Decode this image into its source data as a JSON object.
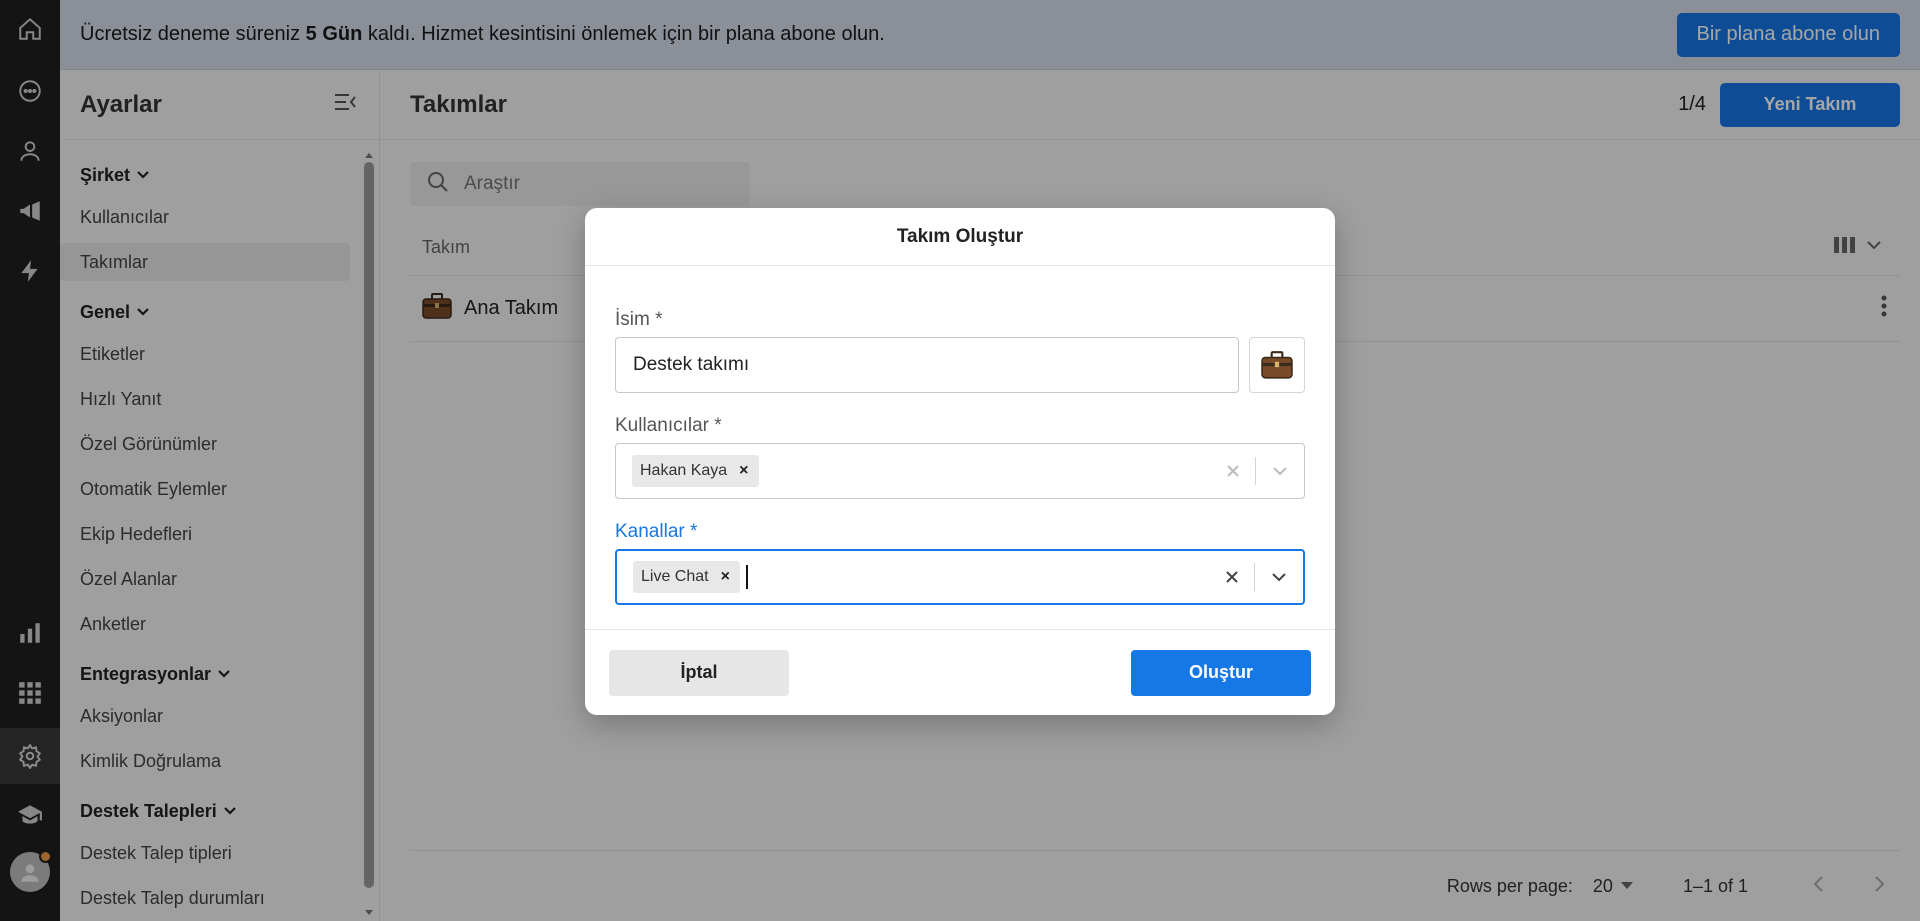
{
  "banner": {
    "prefix": "Ücretsiz deneme süreniz ",
    "days": "5 Gün",
    "suffix": " kaldı. Hizmet kesintisini önlemek için bir plana abone olun.",
    "subscribe_label": "Bir plana abone olun"
  },
  "sidebar": {
    "title": "Ayarlar",
    "groups": [
      {
        "label": "Şirket",
        "items": [
          "Kullanıcılar",
          "Takımlar"
        ]
      },
      {
        "label": "Genel",
        "items": [
          "Etiketler",
          "Hızlı Yanıt",
          "Özel Görünümler",
          "Otomatik Eylemler",
          "Ekip Hedefleri",
          "Özel Alanlar",
          "Anketler"
        ]
      },
      {
        "label": "Entegrasyonlar",
        "items": [
          "Aksiyonlar",
          "Kimlik Doğrulama"
        ]
      },
      {
        "label": "Destek Talepleri",
        "items": [
          "Destek Talep tipleri",
          "Destek Talep durumları"
        ]
      }
    ],
    "active_item": "Takımlar"
  },
  "main": {
    "title": "Takımlar",
    "count": "1/4",
    "new_team_label": "Yeni Takım",
    "search_placeholder": "Araştır",
    "column_team": "Takım",
    "rows": [
      {
        "name": "Ana Takım"
      }
    ],
    "footer": {
      "rows_per_page_label": "Rows per page:",
      "rows_per_page_value": "20",
      "range": "1–1 of 1"
    }
  },
  "modal": {
    "title": "Takım Oluştur",
    "name_label": "İsim *",
    "name_value": "Destek takımı",
    "users_label": "Kullanıcılar *",
    "users_chips": [
      "Hakan Kaya"
    ],
    "channels_label": "Kanallar *",
    "channels_chips": [
      "Live Chat"
    ],
    "cancel_label": "İptal",
    "create_label": "Oluştur"
  },
  "colors": {
    "accent": "#1677e6",
    "rail": "#1f1f1f",
    "banner": "#d5dcea"
  }
}
